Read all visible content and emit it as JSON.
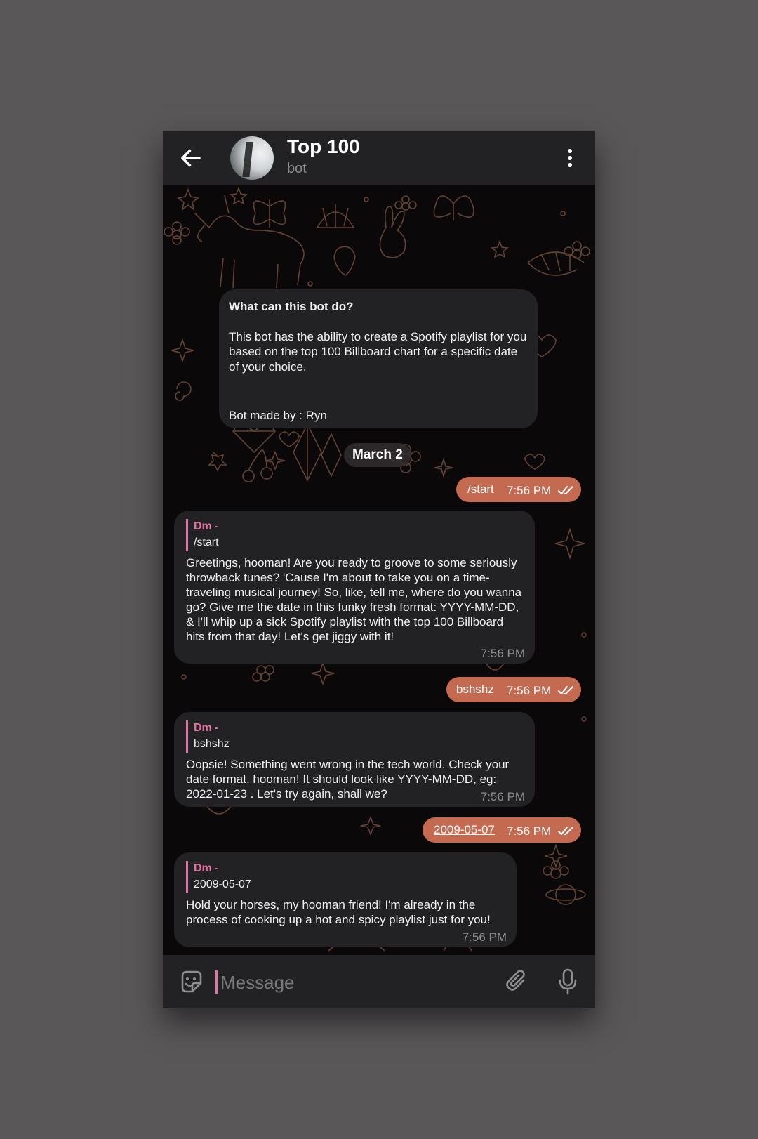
{
  "header": {
    "title": "Top 100",
    "subtitle": "bot"
  },
  "info_card": {
    "heading": "What can this bot do?",
    "body": "This bot has the ability to create a Spotify playlist for you based on the top 100 Billboard chart for a specific date of your choice.",
    "credit": "Bot made by : Ryn"
  },
  "date_divider": "March 2",
  "messages": [
    {
      "direction": "out",
      "text": "/start",
      "time": "7:56 PM"
    },
    {
      "direction": "in",
      "reply_name": "Dm -",
      "reply_text": "/start",
      "text": "Greetings, hooman! Are you ready to groove to some seriously throwback tunes? 'Cause I'm about to take you on a time-traveling musical journey! So, like, tell me, where do you wanna go? Give me the date in this funky fresh format: YYYY-MM-DD, & I'll whip up a sick Spotify playlist with the top 100 Billboard hits from that day! Let's get jiggy with it!",
      "time": "7:56 PM"
    },
    {
      "direction": "out",
      "text": "bshshz",
      "time": "7:56 PM"
    },
    {
      "direction": "in",
      "reply_name": "Dm -",
      "reply_text": "bshshz",
      "text": "Oopsie! Something went wrong in the tech world. Check your date format, hooman! It should look like YYYY-MM-DD, eg: 2022-01-23 . Let's try again, shall we?",
      "time": "7:56 PM"
    },
    {
      "direction": "out",
      "text": "2009-05-07",
      "time": "7:56 PM"
    },
    {
      "direction": "in",
      "reply_name": "Dm -",
      "reply_text": "2009-05-07",
      "text": "Hold your horses, my hooman friend! I'm already in the process of cooking up a hot and spicy playlist just for you!",
      "time": "7:56 PM"
    }
  ],
  "composer": {
    "placeholder": "Message"
  },
  "colors": {
    "header_bg": "#222123",
    "bubble_in": "#222123",
    "bubble_out": "#c46a50",
    "reply_accent": "#e472a6",
    "pattern": "#6b4a3a"
  },
  "icons": [
    "back-arrow-icon",
    "more-vert-icon",
    "double-check-icon",
    "sticker-icon",
    "paperclip-icon",
    "microphone-icon"
  ]
}
